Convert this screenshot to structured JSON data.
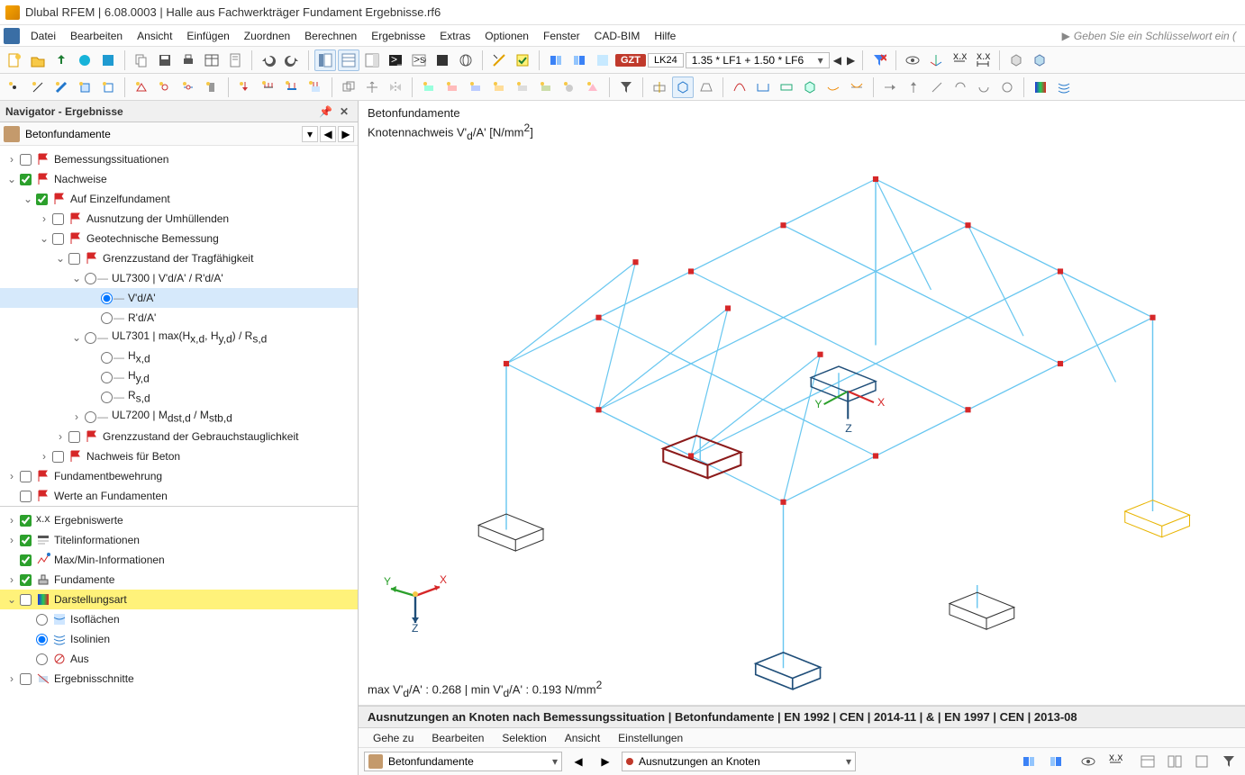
{
  "title": "Dlubal RFEM | 6.08.0003 | Halle aus Fachwerkträger Fundament Ergebnisse.rf6",
  "menus": [
    "Datei",
    "Bearbeiten",
    "Ansicht",
    "Einfügen",
    "Zuordnen",
    "Berechnen",
    "Ergebnisse",
    "Extras",
    "Optionen",
    "Fenster",
    "CAD-BIM",
    "Hilfe"
  ],
  "keyword_hint": "Geben Sie ein Schlüsselwort ein (",
  "toolbar_loadcase": {
    "tag": "GZT",
    "lk": "LK24",
    "combo": "1.35 * LF1 + 1.50 * LF6"
  },
  "navigator": {
    "title": "Navigator - Ergebnisse",
    "subhead": "Betonfundamente",
    "tree": [
      {
        "indent": 0,
        "exp": ">",
        "chk": false,
        "icon": "flag-red",
        "label": "Bemessungssituationen"
      },
      {
        "indent": 0,
        "exp": "v",
        "chk": true,
        "icon": "flag-red",
        "label": "Nachweise"
      },
      {
        "indent": 1,
        "exp": "v",
        "chk": true,
        "icon": "flag-red",
        "label": "Auf Einzelfundament"
      },
      {
        "indent": 2,
        "exp": ">",
        "chk": false,
        "icon": "flag-red",
        "label": "Ausnutzung der Umhüllenden"
      },
      {
        "indent": 2,
        "exp": "v",
        "chk": false,
        "icon": "flag-red",
        "label": "Geotechnische Bemessung"
      },
      {
        "indent": 3,
        "exp": "v",
        "chk": false,
        "icon": "flag-red",
        "label": "Grenzzustand der Tragfähigkeit"
      },
      {
        "indent": 4,
        "exp": "v",
        "radio": false,
        "dash": true,
        "label": "UL7300 | V'd/A' / R'd/A'"
      },
      {
        "indent": 5,
        "exp": "",
        "radio": true,
        "dash": true,
        "label": "V'd/A'",
        "selected": true
      },
      {
        "indent": 5,
        "exp": "",
        "radio": false,
        "dash": true,
        "label": "R'd/A'"
      },
      {
        "indent": 4,
        "exp": "v",
        "radio": false,
        "dash": true,
        "label_html": "UL7301 | max(H<sub>x,d</sub>, H<sub>y,d</sub>) / R<sub>s,d</sub>"
      },
      {
        "indent": 5,
        "exp": "",
        "radio": false,
        "dash": true,
        "label_html": "H<sub>x,d</sub>"
      },
      {
        "indent": 5,
        "exp": "",
        "radio": false,
        "dash": true,
        "label_html": "H<sub>y,d</sub>"
      },
      {
        "indent": 5,
        "exp": "",
        "radio": false,
        "dash": true,
        "label_html": "R<sub>s,d</sub>"
      },
      {
        "indent": 4,
        "exp": ">",
        "radio": false,
        "dash": true,
        "label_html": "UL7200 | M<sub>dst,d</sub> / M<sub>stb,d</sub>"
      },
      {
        "indent": 3,
        "exp": ">",
        "chk": false,
        "icon": "flag-red",
        "label": "Grenzzustand der Gebrauchstauglichkeit"
      },
      {
        "indent": 2,
        "exp": ">",
        "chk": false,
        "icon": "flag-red",
        "label": "Nachweis für Beton"
      },
      {
        "indent": 0,
        "exp": ">",
        "chk": false,
        "icon": "flag-red",
        "label": "Fundamentbewehrung"
      },
      {
        "indent": 0,
        "exp": "",
        "chk": false,
        "icon": "flag-red",
        "label": "Werte an Fundamenten"
      }
    ],
    "bottom": [
      {
        "indent": 0,
        "exp": ">",
        "chk": true,
        "icon": "xxx",
        "label": "Ergebniswerte"
      },
      {
        "indent": 0,
        "exp": ">",
        "chk": true,
        "icon": "title",
        "label": "Titelinformationen"
      },
      {
        "indent": 0,
        "exp": "",
        "chk": true,
        "icon": "maxmin",
        "label": "Max/Min-Informationen"
      },
      {
        "indent": 0,
        "exp": ">",
        "chk": true,
        "icon": "fund",
        "label": "Fundamente"
      },
      {
        "indent": 0,
        "exp": "v",
        "chk": false,
        "icon": "grad",
        "label": "Darstellungsart",
        "hl": true
      },
      {
        "indent": 1,
        "exp": "",
        "radio": false,
        "icon": "iso",
        "label": "Isoflächen"
      },
      {
        "indent": 1,
        "exp": "",
        "radio": true,
        "icon": "lines",
        "label": "Isolinien"
      },
      {
        "indent": 1,
        "exp": "",
        "radio": false,
        "icon": "off",
        "label": "Aus"
      },
      {
        "indent": 0,
        "exp": ">",
        "chk": false,
        "icon": "cut",
        "label": "Ergebnisschnitte"
      }
    ]
  },
  "viewport": {
    "heading1": "Betonfundamente",
    "heading2_html": "Knotennachweis V'<sub>d</sub>/A' [N/mm<sup>2</sup>]",
    "footer_html": "max V'<sub>d</sub>/A' : 0.268 | min V'<sub>d</sub>/A' : 0.193 N/mm<sup>2</sup>",
    "axis": {
      "x": "X",
      "y": "Y",
      "z": "Z"
    },
    "model_axis": {
      "x": "X",
      "y": "Y",
      "z": "Z"
    }
  },
  "results": {
    "header": "Ausnutzungen an Knoten nach Bemessungssituation | Betonfundamente | EN 1992 | CEN | 2014-11 | & | EN 1997 | CEN | 2013-08",
    "menu": [
      "Gehe zu",
      "Bearbeiten",
      "Selektion",
      "Ansicht",
      "Einstellungen"
    ],
    "combo1": "Betonfundamente",
    "combo2": "Ausnutzungen an Knoten"
  }
}
